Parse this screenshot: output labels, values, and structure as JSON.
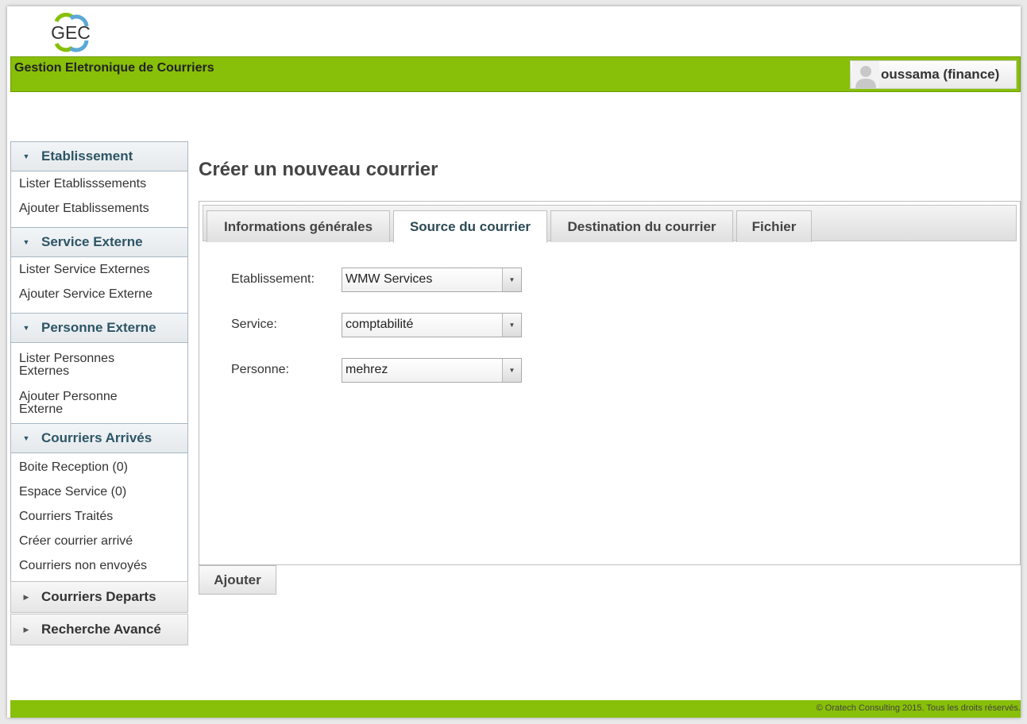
{
  "logo": {
    "text": "GEC"
  },
  "header": {
    "app_title": "Gestion Eletronique de Courriers",
    "user": "oussama (finance)"
  },
  "sidebar": {
    "sections": [
      {
        "title": "Etablissement",
        "expanded": true,
        "links": [
          "Lister Etablisssements",
          "Ajouter Etablissements"
        ]
      },
      {
        "title": "Service Externe",
        "expanded": true,
        "links": [
          "Lister Service Externes",
          "Ajouter Service Externe"
        ]
      },
      {
        "title": "Personne Externe",
        "expanded": true,
        "links": [
          "Lister Personnes Externes",
          "Ajouter Personne Externe"
        ]
      },
      {
        "title": "Courriers Arrivés",
        "expanded": true,
        "links": [
          "Boite Reception (0)",
          "Espace Service (0)",
          "Courriers Traités",
          "Créer courrier arrivé",
          "Courriers non envoyés"
        ]
      },
      {
        "title": "Courriers Departs",
        "expanded": false,
        "links": []
      },
      {
        "title": "Recherche Avancé",
        "expanded": false,
        "links": []
      }
    ]
  },
  "main": {
    "title": "Créer un nouveau courrier",
    "tabs": [
      {
        "label": "Informations générales",
        "active": false
      },
      {
        "label": "Source du courrier",
        "active": true
      },
      {
        "label": "Destination du courrier",
        "active": false
      },
      {
        "label": "Fichier",
        "active": false
      }
    ],
    "form": {
      "etablissement": {
        "label": "Etablissement:",
        "value": "WMW Services"
      },
      "service": {
        "label": "Service:",
        "value": "comptabilité"
      },
      "personne": {
        "label": "Personne:",
        "value": "mehrez"
      }
    },
    "add_button": "Ajouter"
  },
  "footer": {
    "text": "© Oratech Consulting 2015. Tous les droits réservés."
  },
  "colors": {
    "brand_green": "#88bf08",
    "accordion_text": "#2d5566"
  }
}
